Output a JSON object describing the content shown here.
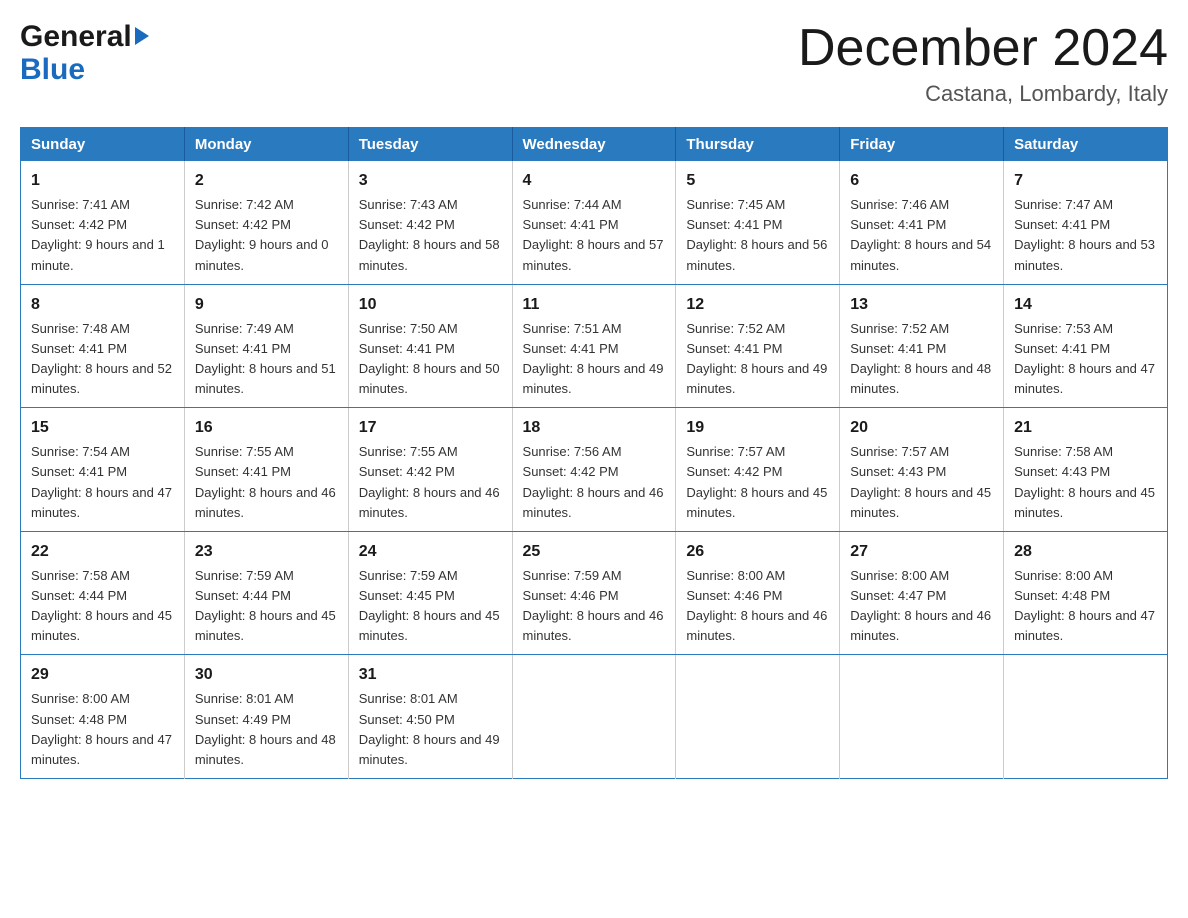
{
  "header": {
    "logo_general": "General",
    "logo_blue": "Blue",
    "month_title": "December 2024",
    "location": "Castana, Lombardy, Italy"
  },
  "days_of_week": [
    "Sunday",
    "Monday",
    "Tuesday",
    "Wednesday",
    "Thursday",
    "Friday",
    "Saturday"
  ],
  "weeks": [
    [
      {
        "day": "1",
        "sunrise": "7:41 AM",
        "sunset": "4:42 PM",
        "daylight": "9 hours and 1 minute."
      },
      {
        "day": "2",
        "sunrise": "7:42 AM",
        "sunset": "4:42 PM",
        "daylight": "9 hours and 0 minutes."
      },
      {
        "day": "3",
        "sunrise": "7:43 AM",
        "sunset": "4:42 PM",
        "daylight": "8 hours and 58 minutes."
      },
      {
        "day": "4",
        "sunrise": "7:44 AM",
        "sunset": "4:41 PM",
        "daylight": "8 hours and 57 minutes."
      },
      {
        "day": "5",
        "sunrise": "7:45 AM",
        "sunset": "4:41 PM",
        "daylight": "8 hours and 56 minutes."
      },
      {
        "day": "6",
        "sunrise": "7:46 AM",
        "sunset": "4:41 PM",
        "daylight": "8 hours and 54 minutes."
      },
      {
        "day": "7",
        "sunrise": "7:47 AM",
        "sunset": "4:41 PM",
        "daylight": "8 hours and 53 minutes."
      }
    ],
    [
      {
        "day": "8",
        "sunrise": "7:48 AM",
        "sunset": "4:41 PM",
        "daylight": "8 hours and 52 minutes."
      },
      {
        "day": "9",
        "sunrise": "7:49 AM",
        "sunset": "4:41 PM",
        "daylight": "8 hours and 51 minutes."
      },
      {
        "day": "10",
        "sunrise": "7:50 AM",
        "sunset": "4:41 PM",
        "daylight": "8 hours and 50 minutes."
      },
      {
        "day": "11",
        "sunrise": "7:51 AM",
        "sunset": "4:41 PM",
        "daylight": "8 hours and 49 minutes."
      },
      {
        "day": "12",
        "sunrise": "7:52 AM",
        "sunset": "4:41 PM",
        "daylight": "8 hours and 49 minutes."
      },
      {
        "day": "13",
        "sunrise": "7:52 AM",
        "sunset": "4:41 PM",
        "daylight": "8 hours and 48 minutes."
      },
      {
        "day": "14",
        "sunrise": "7:53 AM",
        "sunset": "4:41 PM",
        "daylight": "8 hours and 47 minutes."
      }
    ],
    [
      {
        "day": "15",
        "sunrise": "7:54 AM",
        "sunset": "4:41 PM",
        "daylight": "8 hours and 47 minutes."
      },
      {
        "day": "16",
        "sunrise": "7:55 AM",
        "sunset": "4:41 PM",
        "daylight": "8 hours and 46 minutes."
      },
      {
        "day": "17",
        "sunrise": "7:55 AM",
        "sunset": "4:42 PM",
        "daylight": "8 hours and 46 minutes."
      },
      {
        "day": "18",
        "sunrise": "7:56 AM",
        "sunset": "4:42 PM",
        "daylight": "8 hours and 46 minutes."
      },
      {
        "day": "19",
        "sunrise": "7:57 AM",
        "sunset": "4:42 PM",
        "daylight": "8 hours and 45 minutes."
      },
      {
        "day": "20",
        "sunrise": "7:57 AM",
        "sunset": "4:43 PM",
        "daylight": "8 hours and 45 minutes."
      },
      {
        "day": "21",
        "sunrise": "7:58 AM",
        "sunset": "4:43 PM",
        "daylight": "8 hours and 45 minutes."
      }
    ],
    [
      {
        "day": "22",
        "sunrise": "7:58 AM",
        "sunset": "4:44 PM",
        "daylight": "8 hours and 45 minutes."
      },
      {
        "day": "23",
        "sunrise": "7:59 AM",
        "sunset": "4:44 PM",
        "daylight": "8 hours and 45 minutes."
      },
      {
        "day": "24",
        "sunrise": "7:59 AM",
        "sunset": "4:45 PM",
        "daylight": "8 hours and 45 minutes."
      },
      {
        "day": "25",
        "sunrise": "7:59 AM",
        "sunset": "4:46 PM",
        "daylight": "8 hours and 46 minutes."
      },
      {
        "day": "26",
        "sunrise": "8:00 AM",
        "sunset": "4:46 PM",
        "daylight": "8 hours and 46 minutes."
      },
      {
        "day": "27",
        "sunrise": "8:00 AM",
        "sunset": "4:47 PM",
        "daylight": "8 hours and 46 minutes."
      },
      {
        "day": "28",
        "sunrise": "8:00 AM",
        "sunset": "4:48 PM",
        "daylight": "8 hours and 47 minutes."
      }
    ],
    [
      {
        "day": "29",
        "sunrise": "8:00 AM",
        "sunset": "4:48 PM",
        "daylight": "8 hours and 47 minutes."
      },
      {
        "day": "30",
        "sunrise": "8:01 AM",
        "sunset": "4:49 PM",
        "daylight": "8 hours and 48 minutes."
      },
      {
        "day": "31",
        "sunrise": "8:01 AM",
        "sunset": "4:50 PM",
        "daylight": "8 hours and 49 minutes."
      },
      null,
      null,
      null,
      null
    ]
  ]
}
